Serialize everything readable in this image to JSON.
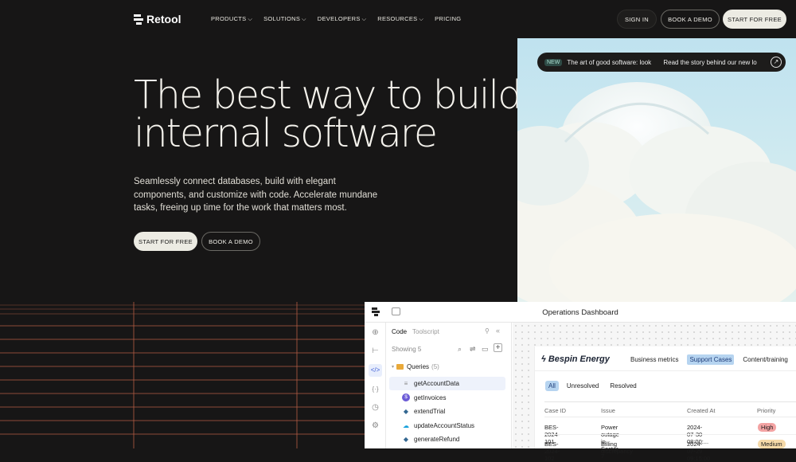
{
  "nav": {
    "brand": "Retool",
    "menu": [
      {
        "label": "PRODUCTS",
        "chev": "⌵"
      },
      {
        "label": "SOLUTIONS",
        "chev": "⌵"
      },
      {
        "label": "DEVELOPERS",
        "chev": "⌵"
      },
      {
        "label": "RESOURCES",
        "chev": "⌵"
      },
      {
        "label": "PRICING",
        "chev": ""
      }
    ],
    "sign_in": "SIGN IN",
    "book_demo": "BOOK A DEMO",
    "start_free": "START FOR FREE"
  },
  "hero": {
    "title_line1": "The best way to build",
    "title_line2": "internal software",
    "subtitle": "Seamlessly connect databases, build with elegant components, and customize with code. Accelerate mundane tasks, freeing up time for the work that matters most.",
    "cta_primary": "START FOR FREE",
    "cta_secondary": "BOOK A DEMO"
  },
  "announcement": {
    "tag": "NEW",
    "text": "The art of good software: look",
    "link_text": "Read the story behind our new lo",
    "icon": "arrow-up-right-icon"
  },
  "app": {
    "window_title": "Operations Dashboard",
    "panel": {
      "tab_code": "Code",
      "tab_toolscript": "Toolscript",
      "showing": "Showing 5",
      "folder_label": "Queries",
      "folder_count": "(5)",
      "queries": [
        {
          "name": "getAccountData",
          "icon": "database-icon",
          "glyph": "≡",
          "color": "#8a8a8a"
        },
        {
          "name": "getInvoices",
          "icon": "stripe-icon",
          "glyph": "$",
          "color": "#6b5bd6"
        },
        {
          "name": "extendTrial",
          "icon": "postgres-icon",
          "glyph": "◆",
          "color": "#336791"
        },
        {
          "name": "updateAccountStatus",
          "icon": "salesforce-icon",
          "glyph": "☁",
          "color": "#16a0db"
        },
        {
          "name": "generateRefund",
          "icon": "postgres-icon",
          "glyph": "◆",
          "color": "#336791"
        }
      ]
    },
    "dashboard": {
      "company": "Bespin Energy",
      "tabs": [
        "Business metrics",
        "Support Cases",
        "Content/training"
      ],
      "active_tab": "Support Cases",
      "filters": [
        "All",
        "Unresolved",
        "Resolved"
      ],
      "columns": [
        "Case ID",
        "Issue",
        "Created At",
        "Priority"
      ],
      "rows": [
        {
          "id": "BES-2024-101",
          "issue": "Power outage in Sector 7",
          "created": "2024-07-30 08:00:...",
          "priority": "High"
        },
        {
          "id": "BES-2024-102",
          "issue": "Billing discrepancy",
          "created": "2024-07-29 09:15:00",
          "priority": "Medium"
        }
      ]
    }
  },
  "colors": {
    "background": "#171616",
    "grid_line": "#c4664a",
    "accent_tab": "#b6d4f0",
    "high": "#f3a3a3",
    "medium": "#f5d9a8"
  }
}
